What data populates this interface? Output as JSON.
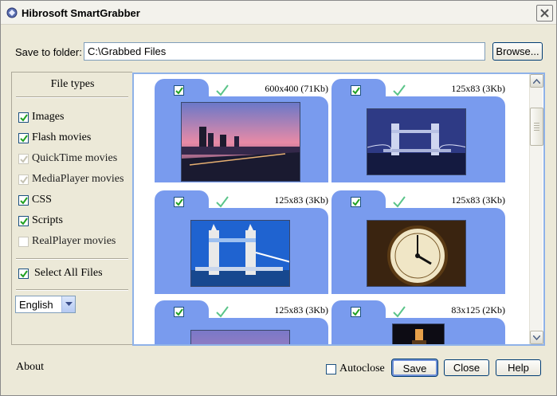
{
  "window": {
    "title": "Hibrosoft SmartGrabber",
    "accent_color": "#799bee"
  },
  "folder": {
    "label": "Save to folder:",
    "value": "C:\\Grabbed Files",
    "browse_label": "Browse..."
  },
  "file_types": {
    "title": "File types",
    "items": [
      {
        "label": "Images",
        "checked": true,
        "enabled": true
      },
      {
        "label": "Flash movies",
        "checked": true,
        "enabled": true
      },
      {
        "label": "QuickTime movies",
        "checked": true,
        "enabled": false
      },
      {
        "label": "MediaPlayer movies",
        "checked": true,
        "enabled": false
      },
      {
        "label": "CSS",
        "checked": true,
        "enabled": true
      },
      {
        "label": "Scripts",
        "checked": true,
        "enabled": true
      },
      {
        "label": "RealPlayer movies",
        "checked": false,
        "enabled": false
      }
    ],
    "select_all_label": "Select All Files"
  },
  "language": {
    "value": "English"
  },
  "gallery": {
    "items": [
      {
        "size": "600x400 (71Kb)",
        "checked": true,
        "thumb": "city-night-river"
      },
      {
        "size": "125x83 (3Kb)",
        "checked": true,
        "thumb": "tower-bridge-night"
      },
      {
        "size": "125x83 (3Kb)",
        "checked": true,
        "thumb": "tower-bridge-day"
      },
      {
        "size": "125x83 (3Kb)",
        "checked": true,
        "thumb": "big-ben-clock"
      },
      {
        "size": "125x83 (3Kb)",
        "checked": true,
        "thumb": "purple-sky"
      },
      {
        "size": "83x125 (2Kb)",
        "checked": true,
        "thumb": "night-tower"
      }
    ]
  },
  "footer": {
    "about_label": "About",
    "autoclose_label": "Autoclose",
    "save_label": "Save",
    "close_label": "Close",
    "help_label": "Help"
  }
}
